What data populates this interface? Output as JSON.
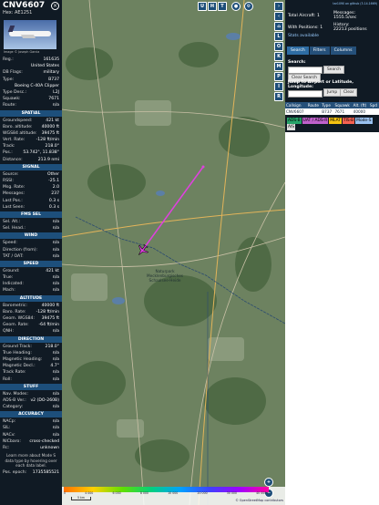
{
  "header": {
    "callsign": "CNV6607",
    "hex": "Hex: AE1251"
  },
  "photo_credit": "Image © Joseph Garcia",
  "info": [
    {
      "k": "Reg.:",
      "v": "161635"
    },
    {
      "k": "",
      "v": "United States"
    },
    {
      "k": "DB Flags:",
      "v": "military"
    },
    {
      "k": "Type:",
      "v": "B737"
    },
    {
      "k": "",
      "v": "Boeing C-40A Clipper"
    },
    {
      "k": "Type Desc.:",
      "v": "L2J"
    },
    {
      "k": "Squawk:",
      "v": "7671"
    },
    {
      "k": "Route:",
      "v": "n/a"
    }
  ],
  "sections": [
    {
      "title": "SPATIAL",
      "rows": [
        {
          "k": "Groundspeed:",
          "v": "421 kt"
        },
        {
          "k": "Baro. altitude:",
          "v": "40000 ft"
        },
        {
          "k": "WGS84 altitude:",
          "v": "39475 ft"
        },
        {
          "k": "Vert. Rate:",
          "v": "-128 ft/min"
        },
        {
          "k": "Track:",
          "v": "218.0°"
        },
        {
          "k": "Pos.:",
          "v": "53.742°, 11.838°"
        },
        {
          "k": "Distance:",
          "v": "213.9 nmi"
        }
      ]
    },
    {
      "title": "SIGNAL",
      "rows": [
        {
          "k": "Source:",
          "v": "Other"
        },
        {
          "k": "RSSI:",
          "v": "-25.1"
        },
        {
          "k": "Msg. Rate:",
          "v": "2.0"
        },
        {
          "k": "Messages:",
          "v": "237"
        },
        {
          "k": "Last Pos.:",
          "v": "0.3 s"
        },
        {
          "k": "Last Seen:",
          "v": "0.3 s"
        }
      ]
    },
    {
      "title": "FMS SEL",
      "rows": [
        {
          "k": "Sel. Alt.:",
          "v": "n/a"
        },
        {
          "k": "Sel. Head.:",
          "v": "n/a"
        }
      ]
    },
    {
      "title": "WIND",
      "rows": [
        {
          "k": "Speed:",
          "v": "n/a"
        },
        {
          "k": "Direction (from):",
          "v": "n/a"
        },
        {
          "k": "TAT / OAT:",
          "v": "n/a"
        }
      ]
    },
    {
      "title": "SPEED",
      "rows": [
        {
          "k": "Ground:",
          "v": "421 kt"
        },
        {
          "k": "True:",
          "v": "n/a"
        },
        {
          "k": "Indicated:",
          "v": "n/a"
        },
        {
          "k": "Mach:",
          "v": "n/a"
        }
      ]
    },
    {
      "title": "ALTITUDE",
      "rows": [
        {
          "k": "Barometric:",
          "v": "40000 ft"
        },
        {
          "k": "Baro. Rate:",
          "v": "-128 ft/min"
        },
        {
          "k": "Geom. WGS84:",
          "v": "39475 ft"
        },
        {
          "k": "Geom. Rate:",
          "v": "-64 ft/min"
        },
        {
          "k": "QNH:",
          "v": "n/a"
        }
      ]
    },
    {
      "title": "DIRECTION",
      "rows": [
        {
          "k": "Ground Track:",
          "v": "218.0°"
        },
        {
          "k": "True Heading:",
          "v": "n/a"
        },
        {
          "k": "Magnetic Heading:",
          "v": "n/a"
        },
        {
          "k": "Magnetic Decl.:",
          "v": "4.7°"
        },
        {
          "k": "Track Rate:",
          "v": "n/a"
        },
        {
          "k": "Roll:",
          "v": "n/a"
        }
      ]
    },
    {
      "title": "STUFF",
      "rows": [
        {
          "k": "Nav. Modes:",
          "v": "n/a"
        },
        {
          "k": "ADS-B Ver.:",
          "v": "v2 (DO-260B)"
        },
        {
          "k": "Category:",
          "v": "n/a"
        }
      ]
    },
    {
      "title": "ACCURACY",
      "rows": [
        {
          "k": "NACp:",
          "v": "n/a"
        },
        {
          "k": "SIL:",
          "v": "n/a"
        },
        {
          "k": "NACv:",
          "v": "n/a"
        },
        {
          "k": "NICbaro:",
          "v": "cross-checked"
        },
        {
          "k": "Rc:",
          "v": "unknown"
        }
      ]
    }
  ],
  "note": "Learn more about Mode S data type by hovering over each data label.",
  "footer": {
    "k": "Pos. epoch:",
    "v": "1735585521"
  },
  "map_buttons": {
    "top": [
      "U",
      "H",
      "T"
    ],
    "side": [
      "L",
      "O",
      "K",
      "M",
      "P",
      "I",
      "R"
    ]
  },
  "map_labels": {
    "reserve": "Naturpark Mecklenburgisches Schaalsee-Heide",
    "scale": "5 km",
    "attribution": "© OpenStreetMap contributors",
    "alt_scale": [
      "0",
      "4 000",
      "6 000",
      "8 000",
      "10 000",
      "20 000",
      "30 000",
      "40 000+"
    ]
  },
  "right": {
    "version": "tar1090 on github (3.14.1669)",
    "stats": [
      {
        "k": "Total Aircraft:",
        "v": "1"
      },
      {
        "k": "With Positions:",
        "v": "1"
      },
      {
        "k": "Messages:",
        "v": "1555.5/sec"
      },
      {
        "k": "History:",
        "v": "22213 positions"
      }
    ],
    "stats_link": "Stats available",
    "tabs": [
      "Search",
      "Filters",
      "Columns"
    ],
    "search_label": "Search:",
    "search_btn": "Search",
    "clear_btn": "Clear Search",
    "jump_label": "Jump to Airport or Latitude, Longitude:",
    "jump_btn": "Jump",
    "clear2_btn": "Clear",
    "columns": [
      "Callsign",
      "Route",
      "Type",
      "Squawk",
      "Alt. (ft)",
      "Spd"
    ],
    "row": [
      "CNV6607",
      "",
      "B737",
      "7671",
      "40000",
      ""
    ],
    "badges": [
      "ADS-B",
      "UAT / ADS-R",
      "MLAT",
      "TIS-B",
      "Mode-S",
      "AIS"
    ],
    "colors": {
      "adsb": "#26a269",
      "uat": "#c061cb",
      "mlat": "#f5c211",
      "tisb": "#f66151",
      "modes": "#99c1f1",
      "ais": "#ddd"
    }
  }
}
